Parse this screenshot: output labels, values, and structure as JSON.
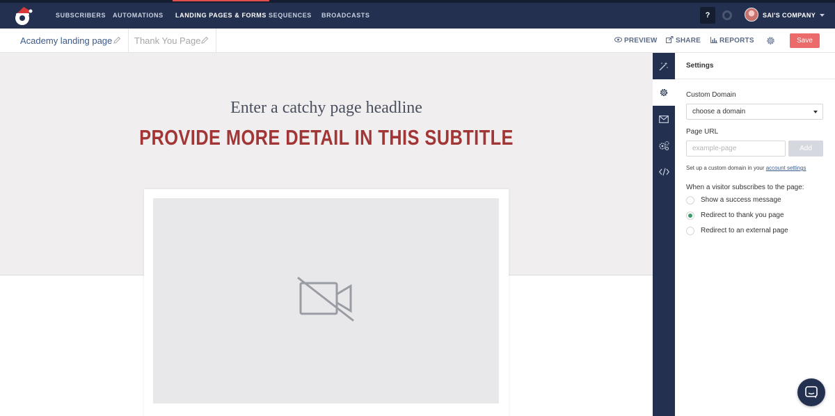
{
  "nav": {
    "items": [
      {
        "label": "SUBSCRIBERS",
        "active": false
      },
      {
        "label": "AUTOMATIONS",
        "active": false
      },
      {
        "label": "LANDING PAGES & FORMS",
        "active": true
      },
      {
        "label": "SEQUENCES",
        "active": false
      },
      {
        "label": "BROADCASTS",
        "active": false
      }
    ],
    "help_label": "?",
    "account_label": "SAI'S COMPANY",
    "accent_color": "#e04e4e"
  },
  "toolbar": {
    "page_tabs": [
      {
        "label": "Academy landing page"
      },
      {
        "label": "Thank You Page"
      }
    ],
    "preview_label": "PREVIEW",
    "share_label": "SHARE",
    "reports_label": "REPORTS",
    "save_label": "Save"
  },
  "canvas": {
    "headline": "Enter a catchy page headline",
    "subtitle": "PROVIDE MORE DETAIL IN THIS SUBTITLE",
    "video_icon": "video-off-icon"
  },
  "rail": {
    "icons": [
      "magic-wand-icon",
      "gear-icon",
      "envelope-icon",
      "integrations-icon",
      "code-icon"
    ],
    "active_index": 1
  },
  "settings": {
    "title": "Settings",
    "custom_domain_label": "Custom Domain",
    "domain_select_value": "choose a domain",
    "page_url_label": "Page URL",
    "page_url_placeholder": "example-page",
    "add_label": "Add",
    "hint_text": "Set up a custom domain in your ",
    "hint_link": "account settings",
    "subscribe_prompt": "When a visitor subscribes to the page:",
    "options": [
      {
        "label": "Show a success message",
        "selected": false
      },
      {
        "label": "Redirect to thank you page",
        "selected": true
      },
      {
        "label": "Redirect to an external page",
        "selected": false
      }
    ]
  }
}
